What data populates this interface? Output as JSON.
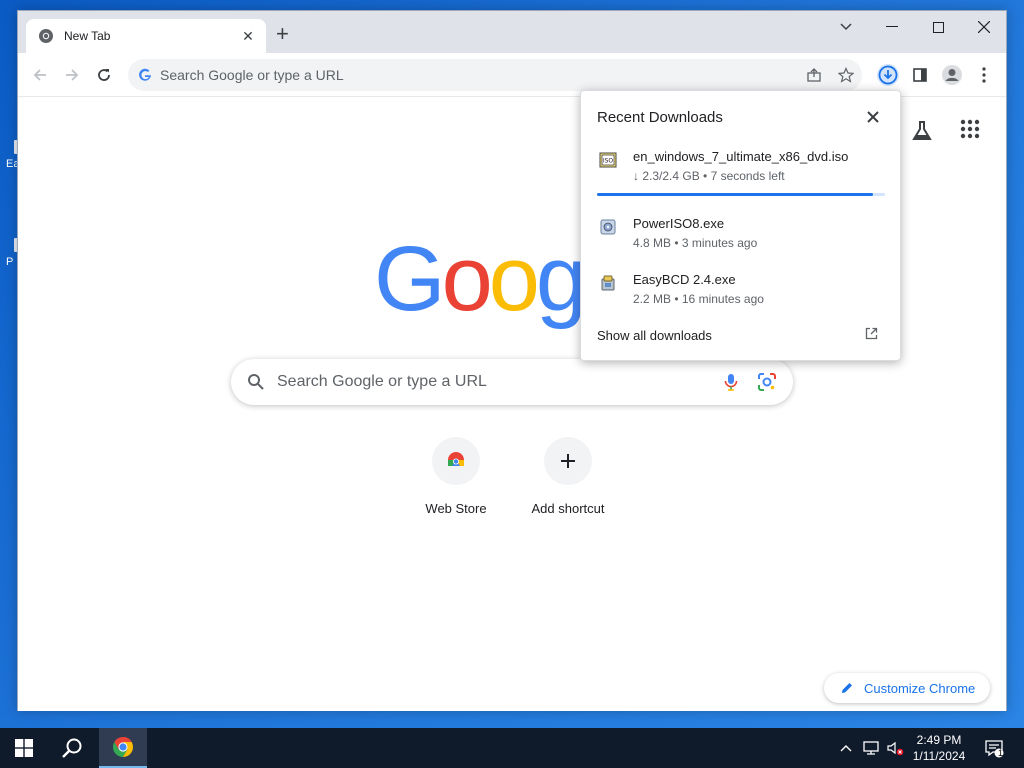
{
  "desktop": {
    "frag1_label": "Ea",
    "frag2_label": "P"
  },
  "browser": {
    "tab_title": "New Tab",
    "omnibox_placeholder": "Search Google or type a URL"
  },
  "ntp": {
    "logo_letters": [
      "G",
      "o",
      "o",
      "g"
    ],
    "logo_colors": [
      "#4285F4",
      "#EA4335",
      "#FBBC05",
      "#4285F4"
    ],
    "search_placeholder": "Search Google or type a URL",
    "shortcuts": [
      {
        "label": "Web Store",
        "icon": "chrome-web-store-icon"
      },
      {
        "label": "Add shortcut",
        "icon": "plus-icon"
      }
    ],
    "customize_label": "Customize Chrome"
  },
  "downloads": {
    "header": "Recent Downloads",
    "items": [
      {
        "name": "en_windows_7_ultimate_x86_dvd.iso",
        "meta": "↓ 2.3/2.4 GB • 7 seconds left",
        "icon": "iso-file-icon",
        "progress": 0.96
      },
      {
        "name": "PowerISO8.exe",
        "meta": "4.8 MB • 3 minutes ago",
        "icon": "installer-icon"
      },
      {
        "name": "EasyBCD 2.4.exe",
        "meta": "2.2 MB • 16 minutes ago",
        "icon": "installer-icon"
      }
    ],
    "show_all": "Show all downloads"
  },
  "taskbar": {
    "time": "2:49 PM",
    "date": "1/11/2024",
    "notification_count": "1"
  },
  "colors": {
    "accent": "#1a73e8",
    "taskbar": "#0f1a2b",
    "desktop": "#1f74d8"
  }
}
